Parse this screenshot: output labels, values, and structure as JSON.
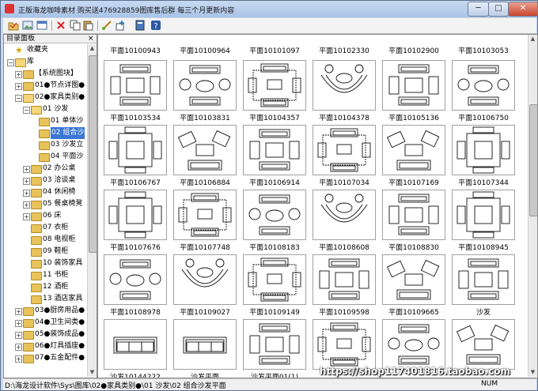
{
  "window": {
    "title": "正版海龙咖啡素材 购买送476928859图库售后群 每三个月更新内容",
    "min_symbol": "─",
    "max_symbol": "□",
    "close_symbol": "✕"
  },
  "toolbar": {
    "icons": [
      "open-icon",
      "image-icon",
      "window-icon",
      "delete-icon",
      "copy-icon",
      "paste-icon",
      "brush-icon",
      "insert-icon",
      "book-icon",
      "help-icon"
    ]
  },
  "panel": {
    "title": "目录面板",
    "close_symbol": "×"
  },
  "tree": [
    {
      "label": "收藏夹",
      "icon": "star",
      "depth": 0,
      "exp": ""
    },
    {
      "label": "库",
      "icon": "folder-open",
      "depth": 0,
      "exp": "−"
    },
    {
      "label": "【系统图块】",
      "icon": "folder",
      "depth": 1,
      "exp": "+"
    },
    {
      "label": "01●节点详图●",
      "icon": "folder",
      "depth": 1,
      "exp": "+"
    },
    {
      "label": "02●家具类别●",
      "icon": "folder-open",
      "depth": 1,
      "exp": "−"
    },
    {
      "label": "01 沙发",
      "icon": "folder-open",
      "depth": 2,
      "exp": "−"
    },
    {
      "label": "01 单体沙",
      "icon": "folder",
      "depth": 3,
      "exp": ""
    },
    {
      "label": "02 组合沙",
      "icon": "folder",
      "depth": 3,
      "exp": "",
      "selected": true
    },
    {
      "label": "03 沙发立",
      "icon": "folder",
      "depth": 3,
      "exp": ""
    },
    {
      "label": "04 平面沙",
      "icon": "folder",
      "depth": 3,
      "exp": ""
    },
    {
      "label": "02 办公桌",
      "icon": "folder",
      "depth": 2,
      "exp": "+"
    },
    {
      "label": "03 洽谈桌",
      "icon": "folder",
      "depth": 2,
      "exp": "+"
    },
    {
      "label": "04 休闲椅",
      "icon": "folder",
      "depth": 2,
      "exp": "+"
    },
    {
      "label": "05 餐桌椅凳",
      "icon": "folder",
      "depth": 2,
      "exp": "+"
    },
    {
      "label": "06 床",
      "icon": "folder",
      "depth": 2,
      "exp": "+"
    },
    {
      "label": "07 衣柜",
      "icon": "folder",
      "depth": 2,
      "exp": ""
    },
    {
      "label": "08 电视柜",
      "icon": "folder",
      "depth": 2,
      "exp": ""
    },
    {
      "label": "09 鞋柜",
      "icon": "folder",
      "depth": 2,
      "exp": ""
    },
    {
      "label": "10 装饰家具",
      "icon": "folder",
      "depth": 2,
      "exp": ""
    },
    {
      "label": "11 书柜",
      "icon": "folder",
      "depth": 2,
      "exp": ""
    },
    {
      "label": "12 酒柜",
      "icon": "folder",
      "depth": 2,
      "exp": ""
    },
    {
      "label": "13 酒店家具",
      "icon": "folder",
      "depth": 2,
      "exp": ""
    },
    {
      "label": "03●厨房用品●",
      "icon": "folder",
      "depth": 1,
      "exp": "+"
    },
    {
      "label": "04●卫生间类●",
      "icon": "folder",
      "depth": 1,
      "exp": "+"
    },
    {
      "label": "05●装饰成品●",
      "icon": "folder",
      "depth": 1,
      "exp": "+"
    },
    {
      "label": "06●灯具插座●",
      "icon": "folder",
      "depth": 1,
      "exp": "+"
    },
    {
      "label": "07●五金配件●",
      "icon": "folder",
      "depth": 1,
      "exp": "+"
    }
  ],
  "top_labels": [
    "平面10100943",
    "平面10100964",
    "平面10101097",
    "平面10102330",
    "平面10102900",
    "平面10103053"
  ],
  "grid": [
    [
      {
        "label": "平面10103534",
        "drawing": "rect-set"
      },
      {
        "label": "平面10103831",
        "drawing": "round-set"
      },
      {
        "label": "平面10104357",
        "drawing": "rug-set"
      },
      {
        "label": "平面10104378",
        "drawing": "curve-set"
      },
      {
        "label": "平面10105136",
        "drawing": "rect-set"
      },
      {
        "label": "平面10106750",
        "drawing": "round-set"
      }
    ],
    [
      {
        "label": "平面10106767",
        "drawing": "square-set"
      },
      {
        "label": "平面10106884",
        "drawing": "angled-set"
      },
      {
        "label": "平面10106914",
        "drawing": "rect-set"
      },
      {
        "label": "平面10107034",
        "drawing": "rug-set"
      },
      {
        "label": "平面10107169",
        "drawing": "angled-set"
      },
      {
        "label": "平面10107344",
        "drawing": "square-set"
      }
    ],
    [
      {
        "label": "平面10107676",
        "drawing": "square-set"
      },
      {
        "label": "平面10107748",
        "drawing": "rug-set"
      },
      {
        "label": "平面10108183",
        "drawing": "round-set"
      },
      {
        "label": "平面10108608",
        "drawing": "curve-set"
      },
      {
        "label": "平面10108830",
        "drawing": "rect-set"
      },
      {
        "label": "平面10108945",
        "drawing": "square-set"
      }
    ],
    [
      {
        "label": "平面10108978",
        "drawing": "round-set"
      },
      {
        "label": "平面10109027",
        "drawing": "curve-set"
      },
      {
        "label": "平面10109149",
        "drawing": "rug-set"
      },
      {
        "label": "平面10109598",
        "drawing": "rect-set"
      },
      {
        "label": "平面10109665",
        "drawing": "angled-set"
      },
      {
        "label": "沙发",
        "drawing": "rect-set"
      }
    ],
    [
      {
        "label": "沙发10144222",
        "drawing": "sofa-plain"
      },
      {
        "label": "沙发平面",
        "drawing": "sofa-plain"
      },
      {
        "label": "沙发平面01(1)",
        "drawing": "rect-set"
      },
      {
        "label": "",
        "drawing": "rug-set"
      },
      {
        "label": "",
        "drawing": "round-set"
      },
      {
        "label": "",
        "drawing": "angled-set"
      }
    ]
  ],
  "status": {
    "path": "D:\\海龙设计软件\\Sys\\图库\\02●家具类别●\\01 沙发\\02 组合沙发平面",
    "num": "NUM"
  },
  "watermark": "https://shop117401816.taobao.com"
}
